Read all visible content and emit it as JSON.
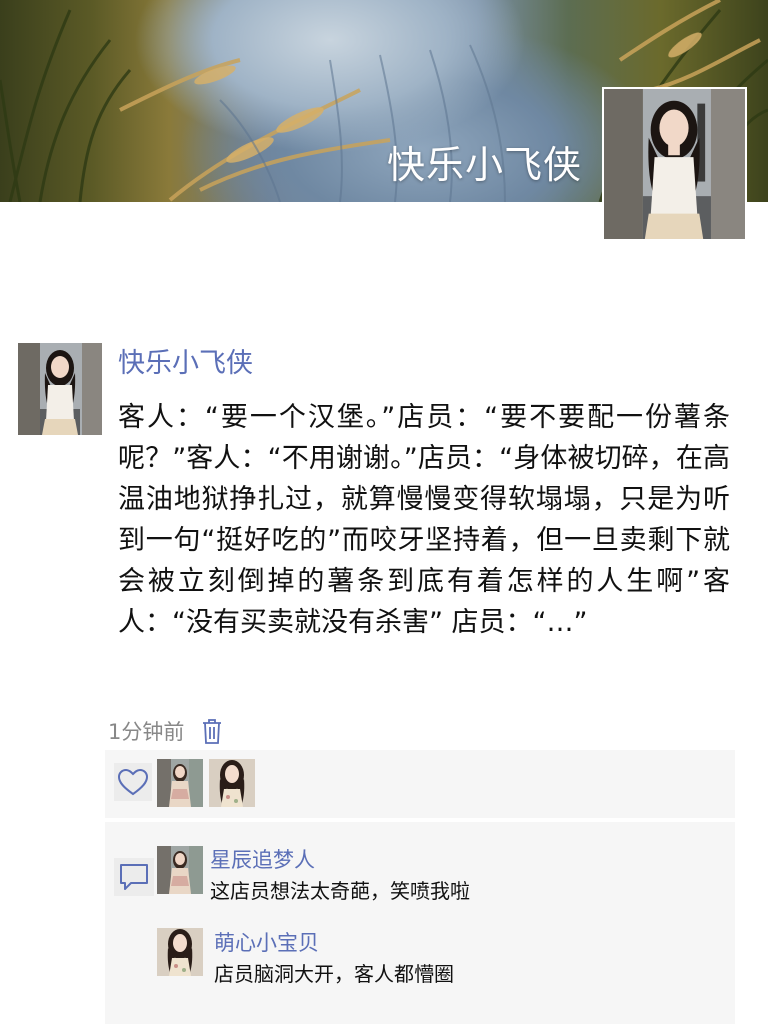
{
  "cover": {
    "title": "快乐小飞侠"
  },
  "post": {
    "author": "快乐小飞侠",
    "text": "客人：“要一个汉堡。”店员：“要不要配一份薯条呢？”客人：“不用谢谢。”店员：“身体被切碎，在高温油地狱挣扎过，就算慢慢变得软塌塌，只是为听到一句“挺好吃的”而咬牙坚持着，但一旦卖剩下就会被立刻倒掉的薯条到底有着怎样的人生啊”客人：“没有买卖就没有杀害” 店员：“…”",
    "time": "1分钟前",
    "delete_icon": "trash-icon"
  },
  "likes": {
    "icon": "heart-icon",
    "count_avatars": 2
  },
  "comments": [
    {
      "author": "星辰追梦人",
      "text": "这店员想法太奇葩，笑喷我啦"
    },
    {
      "author": "萌心小宝贝",
      "text": "店员脑洞大开，客人都懵圈"
    }
  ],
  "colors": {
    "name_blue": "#5b6fb7",
    "panel_bg": "#f6f6f6",
    "meta_gray": "#888888"
  }
}
